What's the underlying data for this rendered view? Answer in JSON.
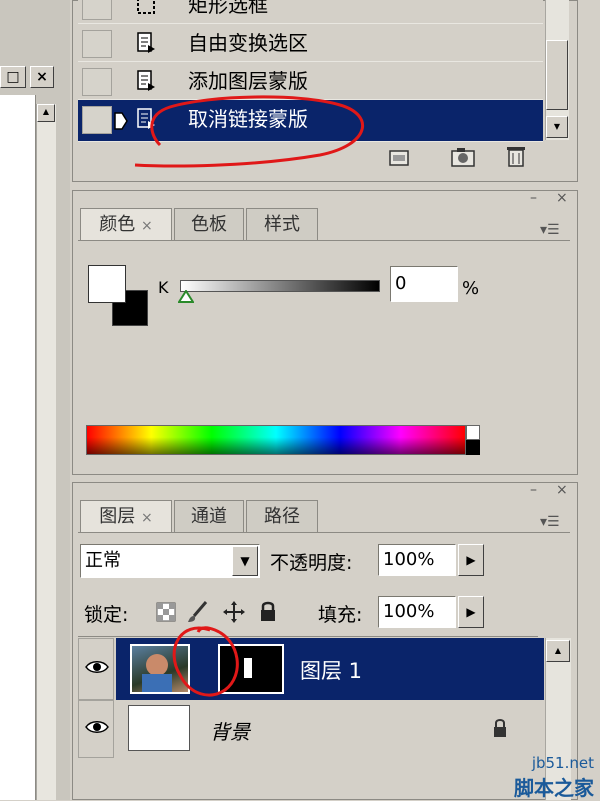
{
  "history": {
    "items": [
      {
        "label": "矩形选框",
        "selected": false
      },
      {
        "label": "自由变换选区",
        "selected": false
      },
      {
        "label": "添加图层蒙版",
        "selected": false
      },
      {
        "label": "取消链接蒙版",
        "selected": true
      }
    ]
  },
  "color_panel": {
    "tabs": [
      {
        "label": "颜色",
        "active": true
      },
      {
        "label": "色板",
        "active": false
      },
      {
        "label": "样式",
        "active": false
      }
    ],
    "close_glyph": "×",
    "channel_label": "K",
    "value": "0",
    "unit": "%",
    "minimize_glyph": "–",
    "panel_close_glyph": "×",
    "menu_glyph": "▾☰"
  },
  "layers_panel": {
    "tabs": [
      {
        "label": "图层",
        "active": true
      },
      {
        "label": "通道",
        "active": false
      },
      {
        "label": "路径",
        "active": false
      }
    ],
    "blend_mode": "正常",
    "opacity_label": "不透明度:",
    "opacity_value": "100%",
    "lock_label": "锁定:",
    "fill_label": "填充:",
    "fill_value": "100%",
    "layers": [
      {
        "name": "图层 1",
        "selected": true
      },
      {
        "name": "背景",
        "selected": false
      }
    ]
  },
  "window_buttons": {
    "restore": "□",
    "close": "×"
  },
  "watermark": {
    "site": "jb51.net",
    "name": "脚本之家"
  },
  "colors": {
    "selection": "#0a246a",
    "annotation": "#e01818"
  }
}
